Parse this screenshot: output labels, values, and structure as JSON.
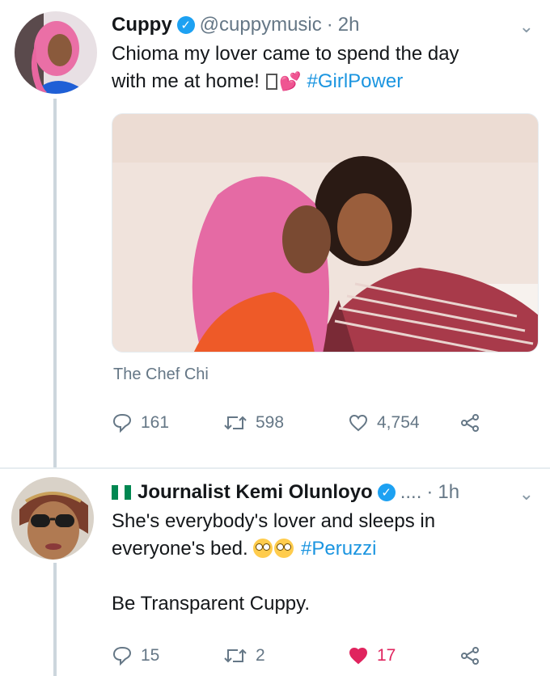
{
  "tweet1": {
    "name": "Cuppy",
    "handle": "@cuppymusic",
    "sep": "·",
    "time": "2h",
    "text_line1": "Chioma my lover came to spend the day",
    "text_line2": "with me at home! ",
    "hashtag": "#GirlPower",
    "caption": "The Chef Chi",
    "replies": "161",
    "retweets": "598",
    "likes": "4,754"
  },
  "tweet2": {
    "flag": "Nigeria flag",
    "name": "Journalist Kemi Olunloyo",
    "ellipsis": "....",
    "sep": "·",
    "time": "1h",
    "text_line1": "She's everybody's lover and sleeps in",
    "text_line2": "everyone's bed. ",
    "hashtag": "#Peruzzi",
    "text_line3": "Be Transparent Cuppy.",
    "replies": "15",
    "retweets": "2",
    "likes": "17"
  },
  "colors": {
    "link": "#1b95e0",
    "verified": "#1da1f2",
    "muted": "#657786",
    "like": "#e0245e"
  }
}
